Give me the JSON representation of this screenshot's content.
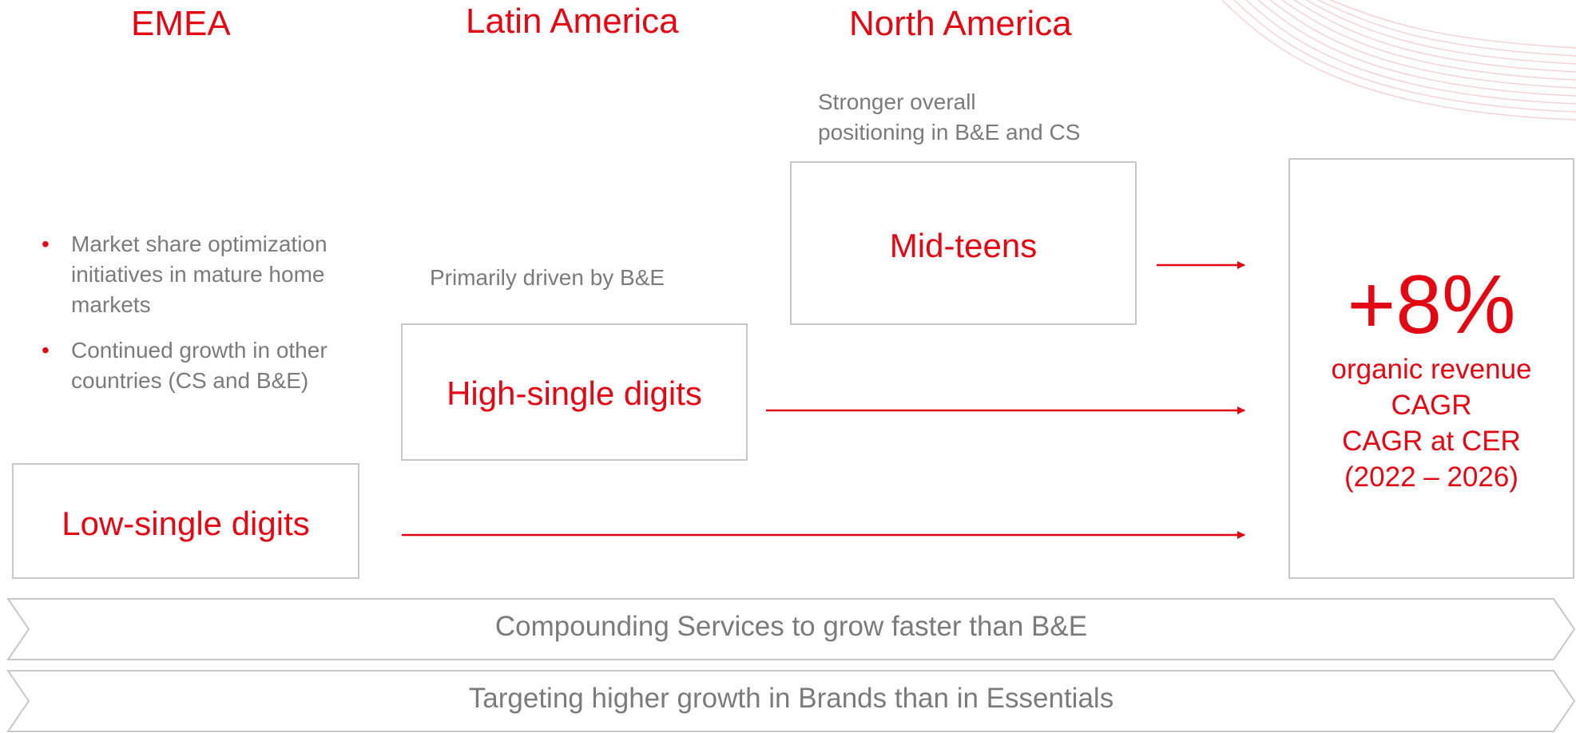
{
  "regions": {
    "emea": {
      "title": "EMEA",
      "bullets": [
        "Market share optimization initiatives in mature home markets",
        "Continued growth in other countries (CS and B&E)"
      ],
      "box_label": "Low-single digits"
    },
    "latam": {
      "title": "Latin America",
      "note": "Primarily driven by B&E",
      "box_label": "High-single digits"
    },
    "na": {
      "title": "North America",
      "note_line1": "Stronger overall",
      "note_line2": "positioning in B&E and CS",
      "box_label": "Mid-teens"
    }
  },
  "result": {
    "value": "+8%",
    "line1": "organic revenue",
    "line2": "CAGR",
    "line3": "CAGR at CER",
    "line4": "(2022 – 2026)"
  },
  "bands": [
    "Compounding Services to grow faster than B&E",
    "Targeting higher growth in Brands than in Essentials"
  ],
  "bullet_symbol": "•",
  "colors": {
    "accent": "#e30613",
    "text_grey": "#7b7b7b",
    "border_grey": "#c8c8c8"
  }
}
